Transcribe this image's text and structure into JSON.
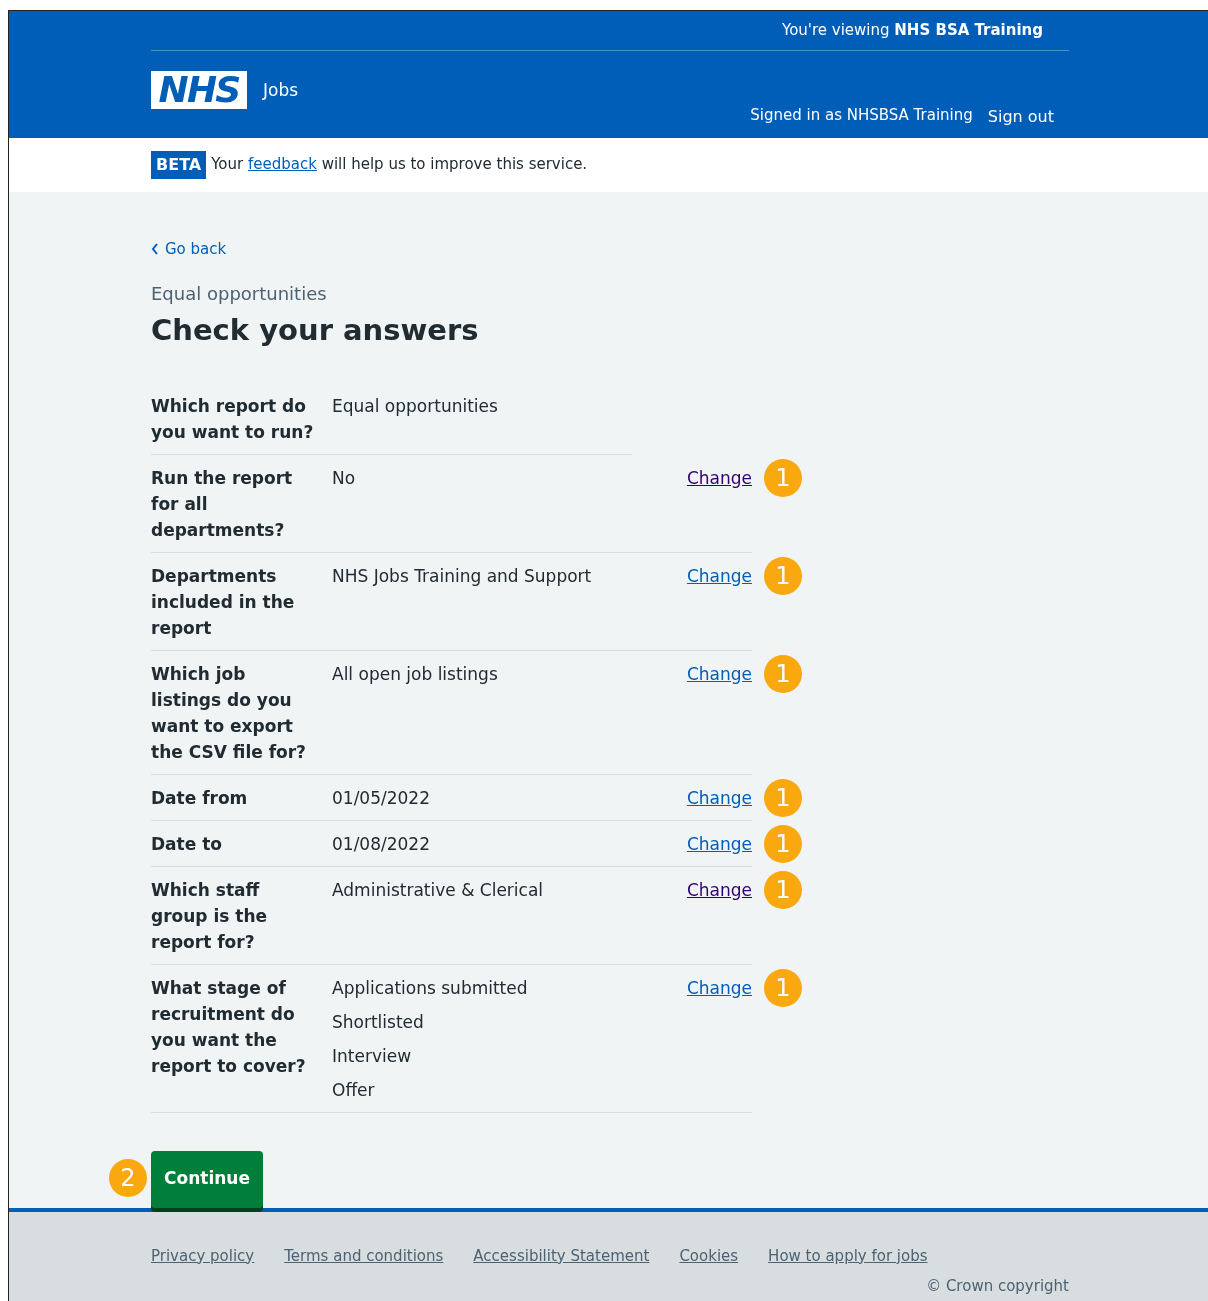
{
  "header": {
    "viewing_prefix": "You're viewing",
    "viewing_org": "NHS BSA Training",
    "logo": "NHS",
    "service": "Jobs",
    "signed_in": "Signed in as NHSBSA Training",
    "sign_out": "Sign out"
  },
  "beta_banner": {
    "tag": "BETA",
    "text_before": "Your",
    "link": "feedback",
    "text_after": "will help us to improve this service."
  },
  "back_link": "Go back",
  "caption": "Equal opportunities",
  "heading": "Check your answers",
  "summary": [
    {
      "key": "Which report do you want to run?",
      "values": [
        "Equal opportunities"
      ]
    },
    {
      "key": "Run the report for all departments?",
      "values": [
        "No"
      ],
      "action": "Change",
      "visited": true,
      "annotation": "1"
    },
    {
      "key": "Departments included in the report",
      "values": [
        "NHS Jobs Training and Support"
      ],
      "action": "Change",
      "visited": false,
      "annotation": "1"
    },
    {
      "key": "Which job listings do you want to export the CSV file for?",
      "values": [
        "All open job listings"
      ],
      "action": "Change",
      "visited": false,
      "annotation": "1"
    },
    {
      "key": "Date from",
      "values": [
        "01/05/2022"
      ],
      "action": "Change",
      "visited": false,
      "annotation": "1"
    },
    {
      "key": "Date to",
      "values": [
        "01/08/2022"
      ],
      "action": "Change",
      "visited": false,
      "annotation": "1"
    },
    {
      "key": "Which staff group is the report for?",
      "values": [
        "Administrative & Clerical"
      ],
      "action": "Change",
      "visited": true,
      "annotation": "1"
    },
    {
      "key": "What stage of recruitment do you want the report to cover?",
      "values": [
        "Applications submitted",
        "Shortlisted",
        "Interview",
        "Offer"
      ],
      "action": "Change",
      "visited": false,
      "annotation": "1"
    }
  ],
  "continue_button": {
    "label": "Continue",
    "annotation": "2"
  },
  "footer": {
    "links": [
      "Privacy policy",
      "Terms and conditions",
      "Accessibility Statement",
      "Cookies",
      "How to apply for jobs"
    ],
    "copyright": "© Crown copyright"
  }
}
